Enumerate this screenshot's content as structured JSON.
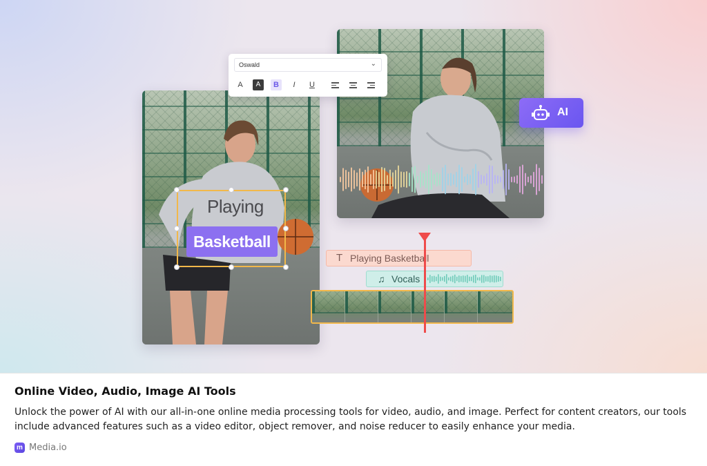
{
  "hero": {
    "toolbar": {
      "font_name": "Oswald",
      "buttons": {
        "font_color": "A",
        "highlight": "A",
        "bold": "B",
        "italic": "I",
        "underline": "U"
      }
    },
    "ai_badge": {
      "label": "AI",
      "color": "#7a5cf5"
    },
    "caption": {
      "line1": "Playing",
      "line2": "Basketball",
      "line2_bg": "#8c70f0"
    },
    "timeline": {
      "text_track": {
        "label": "Playing Basketball",
        "icon": "text-icon"
      },
      "audio_track": {
        "label": "Vocals",
        "icon": "music-note-icon"
      },
      "playhead_color": "#ef4b4b"
    }
  },
  "card": {
    "title": "Online Video, Audio, Image AI Tools",
    "description": "Unlock the power of AI with our all-in-one online media processing tools for video, audio, and image. Perfect for content creators, our tools include advanced features such as a video editor, object remover, and noise reducer to easily enhance your media.",
    "brand": {
      "logo_letter": "m",
      "name": "Media.io"
    }
  }
}
